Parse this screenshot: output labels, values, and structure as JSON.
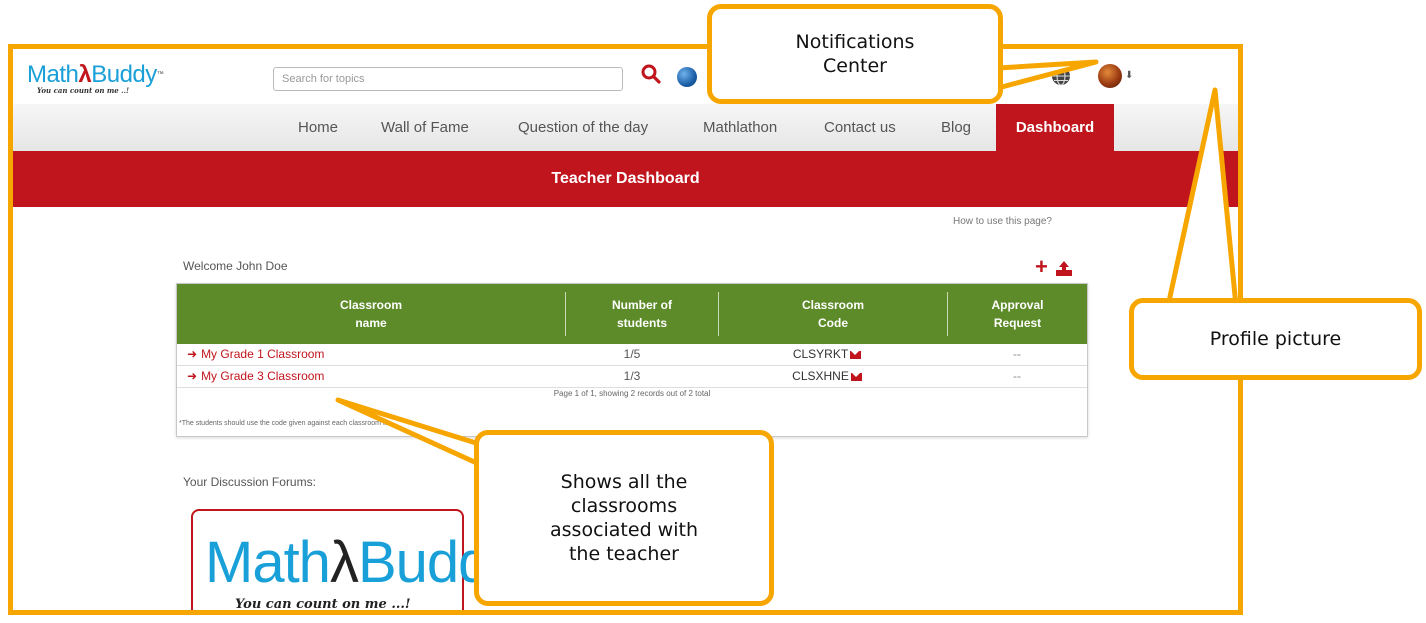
{
  "header": {
    "logo_text": "Math",
    "logo_text2": "Buddy",
    "logo_tm": "™",
    "logo_tagline": "You can count on me ..!",
    "search_placeholder": "Search for topics"
  },
  "nav": {
    "items": [
      {
        "label": "Home"
      },
      {
        "label": "Wall of Fame"
      },
      {
        "label": "Question of the day"
      },
      {
        "label": "Mathlathon"
      },
      {
        "label": "Contact us"
      },
      {
        "label": "Blog"
      },
      {
        "label": "Dashboard",
        "active": true
      }
    ]
  },
  "banner": {
    "title": "Teacher Dashboard"
  },
  "page": {
    "how_to": "How to use this page?",
    "welcome": "Welcome John Doe",
    "forums_title": "Your Discussion Forums:"
  },
  "table": {
    "headers": [
      {
        "line1": "Classroom",
        "line2": "name"
      },
      {
        "line1": "Number of",
        "line2": "students"
      },
      {
        "line1": "Classroom",
        "line2": "Code"
      },
      {
        "line1": "Approval",
        "line2": "Request"
      }
    ],
    "rows": [
      {
        "name": "My Grade 1 Classroom",
        "students": "1/5",
        "code": "CLSYRKT",
        "approval": "--"
      },
      {
        "name": "My Grade 3 Classroom",
        "students": "1/3",
        "code": "CLSXHNE",
        "approval": "--"
      }
    ],
    "page_info": "Page 1 of 1, showing 2 records out of 2 total",
    "footnote": "*The students should use the code given against each classroom to join"
  },
  "forum_card": {
    "logo_text": "Math",
    "logo_text2": "Buddy",
    "logo_tm": "TM",
    "tagline": "You can count on me ...!"
  },
  "callouts": {
    "notifications": {
      "line1": "Notifications",
      "line2": "Center"
    },
    "profile": "Profile picture",
    "classrooms": {
      "line1": "Shows all the",
      "line2": "classrooms",
      "line3": "associated with",
      "line4": "the teacher"
    }
  },
  "colors": {
    "accent_red": "#c0151c",
    "header_green": "#5e8b2a",
    "callout_orange": "#f7a600",
    "logo_blue": "#1aa0d8"
  }
}
